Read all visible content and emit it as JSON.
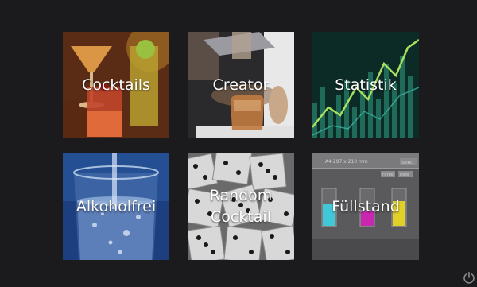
{
  "tiles": [
    {
      "id": "cocktails",
      "label": "Cocktails"
    },
    {
      "id": "creator",
      "label": "Creator"
    },
    {
      "id": "statistik",
      "label": "Statistik"
    },
    {
      "id": "alkoholfrei",
      "label": "Alkoholfrei"
    },
    {
      "id": "random",
      "label": "Random\nCocktail"
    },
    {
      "id": "fuellstand",
      "label": "Füllstand",
      "image_text": [
        "A4 297 x 210 mm",
        "Farbe",
        "Hilfe",
        "Seite1"
      ]
    }
  ],
  "icons": {
    "power": "power-icon"
  },
  "colors": {
    "background": "#1b1a1c",
    "label": "#ffffff"
  }
}
